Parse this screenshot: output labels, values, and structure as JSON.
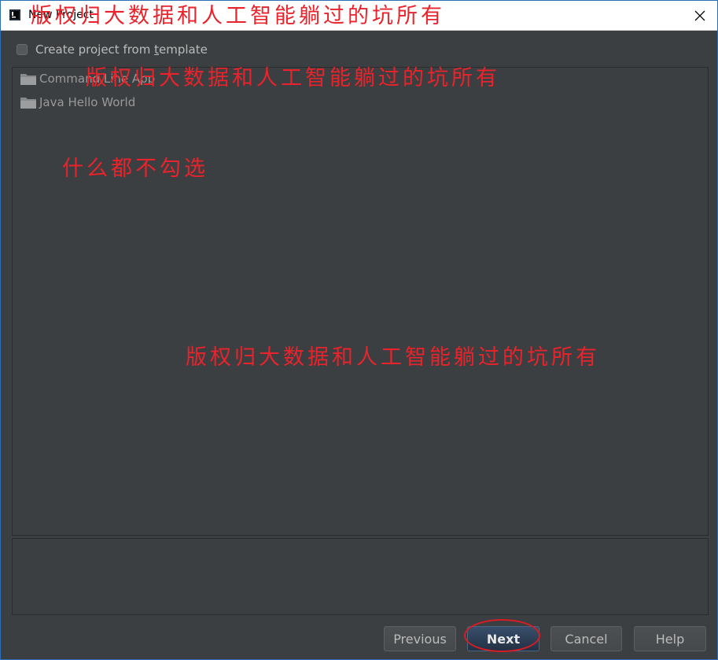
{
  "window": {
    "title": "New Project"
  },
  "options": {
    "template_label_before": "Create project from ",
    "template_label_mnemonic": "t",
    "template_label_after": "emplate",
    "checked": false
  },
  "templates": [
    "Command Line App",
    "Java Hello World"
  ],
  "buttons": {
    "previous": "Previous",
    "next": "Next",
    "cancel": "Cancel",
    "help": "Help"
  },
  "annotations": {
    "watermark": "版权归大数据和人工智能躺过的坑所有",
    "note": "什么都不勾选"
  },
  "colors": {
    "annotation": "#e8232b",
    "background": "#3c3f41",
    "default_button": "#2e4159"
  }
}
